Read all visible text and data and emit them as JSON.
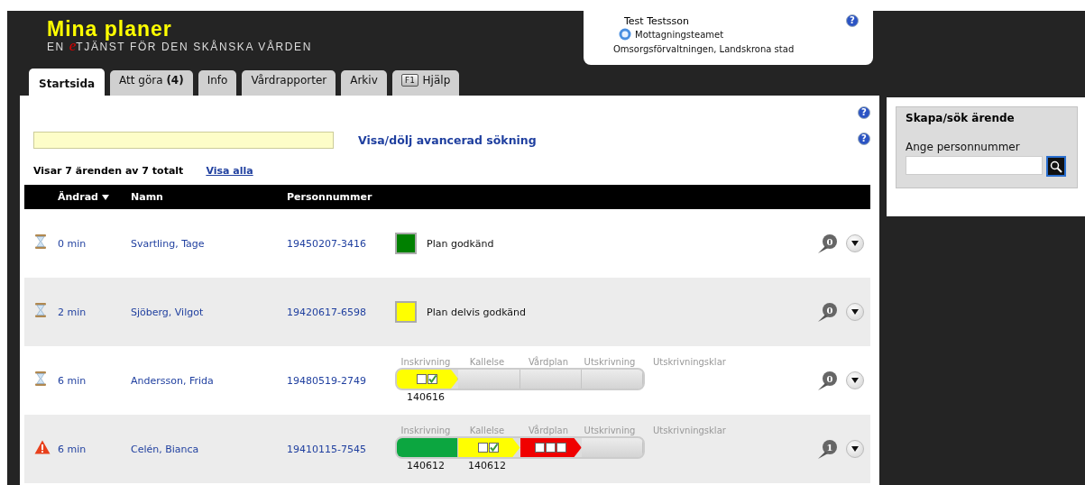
{
  "logo": {
    "title": "Mina planer",
    "prefix": "EN",
    "accent": "e",
    "rest": "TJÄNST FÖR DEN SKÅNSKA VÅRDEN"
  },
  "user": {
    "name": "Test Testsson",
    "team": "Mottagningsteamet",
    "organization": "Omsorgsförvaltningen, Landskrona stad",
    "help": "?"
  },
  "tabs": [
    {
      "label": "Startsida",
      "selected": true
    },
    {
      "label": "Att göra **(4)**",
      "selected": false
    },
    {
      "label": "Info",
      "selected": false
    },
    {
      "label": "Vårdrapporter",
      "selected": false
    },
    {
      "label": "Arkiv",
      "selected": false
    },
    {
      "label": "Hjälp",
      "key": "F1",
      "selected": false
    }
  ],
  "page_help": "?",
  "search": {
    "advanced_link": "Visa/dölj avancerad sökning",
    "help": "?"
  },
  "summary": {
    "text": "Visar 7 ärenden av 7 totalt",
    "show_all": "Visa alla"
  },
  "table": {
    "columns": [
      {
        "label": "Ändrad",
        "sorted": true
      },
      {
        "label": "Namn",
        "sorted": false
      },
      {
        "label": "Personnummer",
        "sorted": false
      }
    ],
    "rows": [
      {
        "alert": false,
        "changed": "0 min",
        "name": "Svartling, Tage",
        "pnr": "19450207-3416",
        "status": {
          "kind": "simple",
          "color": "#008000",
          "label": "Plan godkänd"
        },
        "comments": "0"
      },
      {
        "alert": false,
        "changed": "2 min",
        "name": "Sjöberg, Vilgot",
        "pnr": "19420617-6598",
        "status": {
          "kind": "simple",
          "color": "#ffff00",
          "label": "Plan delvis godkänd"
        },
        "comments": "0"
      },
      {
        "alert": false,
        "changed": "6 min",
        "name": "Andersson, Frida",
        "pnr": "19480519-2749",
        "status": {
          "kind": "progress",
          "final_label": "Utskrivningsklar",
          "stages": [
            {
              "label": "Inskrivning",
              "color": "#ffff00",
              "boxes": [
                false,
                true
              ],
              "date": "140616"
            },
            {
              "label": "Kallelse"
            },
            {
              "label": "Vårdplan"
            },
            {
              "label": "Utskrivning"
            }
          ]
        },
        "comments": "0"
      },
      {
        "alert": true,
        "changed": "6 min",
        "name": "Celén, Bianca",
        "pnr": "19410115-7545",
        "status": {
          "kind": "progress",
          "final_label": "Utskrivningsklar",
          "stages": [
            {
              "label": "Inskrivning",
              "color": "#0ca640",
              "date": "140612"
            },
            {
              "label": "Kallelse",
              "color": "#ffff00",
              "boxes": [
                false,
                true
              ],
              "date": "140612"
            },
            {
              "label": "Vårdplan",
              "color": "#f00000",
              "boxes": [
                false,
                false,
                false
              ]
            },
            {
              "label": "Utskrivning"
            }
          ]
        },
        "comments": "1"
      }
    ]
  },
  "sidebar": {
    "title": "Skapa/sök ärende",
    "field_label": "Ange personnummer"
  }
}
